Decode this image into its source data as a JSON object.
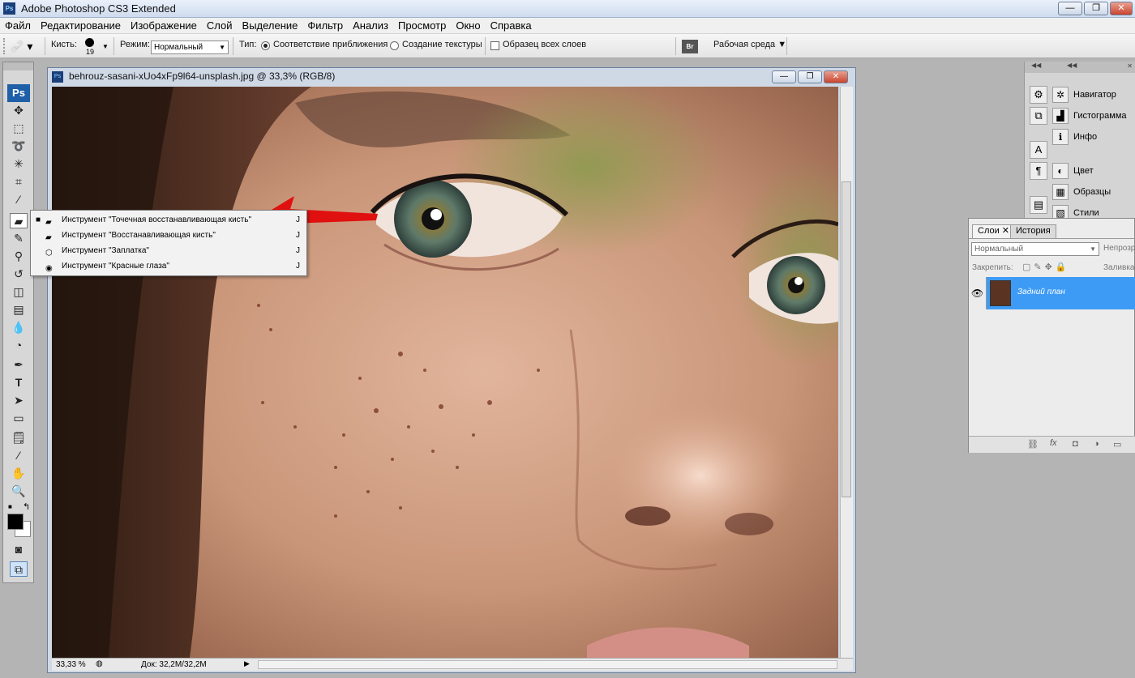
{
  "window": {
    "title": "Adobe Photoshop CS3 Extended",
    "app_icon": "Ps"
  },
  "menu": [
    "Файл",
    "Редактирование",
    "Изображение",
    "Слой",
    "Выделение",
    "Фильтр",
    "Анализ",
    "Просмотр",
    "Окно",
    "Справка"
  ],
  "options": {
    "brush_label": "Кисть:",
    "brush_size": "19",
    "mode_label": "Режим:",
    "mode_value": "Нормальный",
    "type_label": "Тип:",
    "type_option1": "Соответствие приближения",
    "type_option2": "Создание текстуры",
    "sample_all": "Образец всех слоев",
    "bridge": "Br",
    "workspace": "Рабочая среда"
  },
  "toolbox": {
    "logo": "Ps"
  },
  "document": {
    "title": "behrouz-sasani-xUo4xFp9l64-unsplash.jpg @ 33,3% (RGB/8)",
    "zoom": "33,33 %",
    "doc_info": "Док: 32,2M/32,2M"
  },
  "flyout": [
    {
      "label": "Инструмент \"Точечная восстанавливающая кисть\"",
      "key": "J",
      "selected": true
    },
    {
      "label": "Инструмент \"Восстанавливающая кисть\"",
      "key": "J",
      "selected": false
    },
    {
      "label": "Инструмент \"Заплатка\"",
      "key": "J",
      "selected": false
    },
    {
      "label": "Инструмент \"Красные глаза\"",
      "key": "J",
      "selected": false
    }
  ],
  "dock_panels": [
    {
      "label": "Навигатор",
      "icon": "navigator-icon"
    },
    {
      "label": "Гистограмма",
      "icon": "histogram-icon"
    },
    {
      "label": "Инфо",
      "icon": "info-icon"
    },
    {
      "label": "Цвет",
      "icon": "color-icon"
    },
    {
      "label": "Образцы",
      "icon": "swatches-icon"
    },
    {
      "label": "Стили",
      "icon": "styles-icon"
    }
  ],
  "layers_panel": {
    "tab_layers": "Слои",
    "tab_history": "История",
    "blend_mode": "Нормальный",
    "opacity_label": "Непрозр",
    "lock_label": "Закрепить:",
    "fill_label": "Заливка",
    "layer_name": "Задний план"
  },
  "colors": {
    "accent_selection": "#3e9bf5",
    "arrow": "#e01010"
  }
}
